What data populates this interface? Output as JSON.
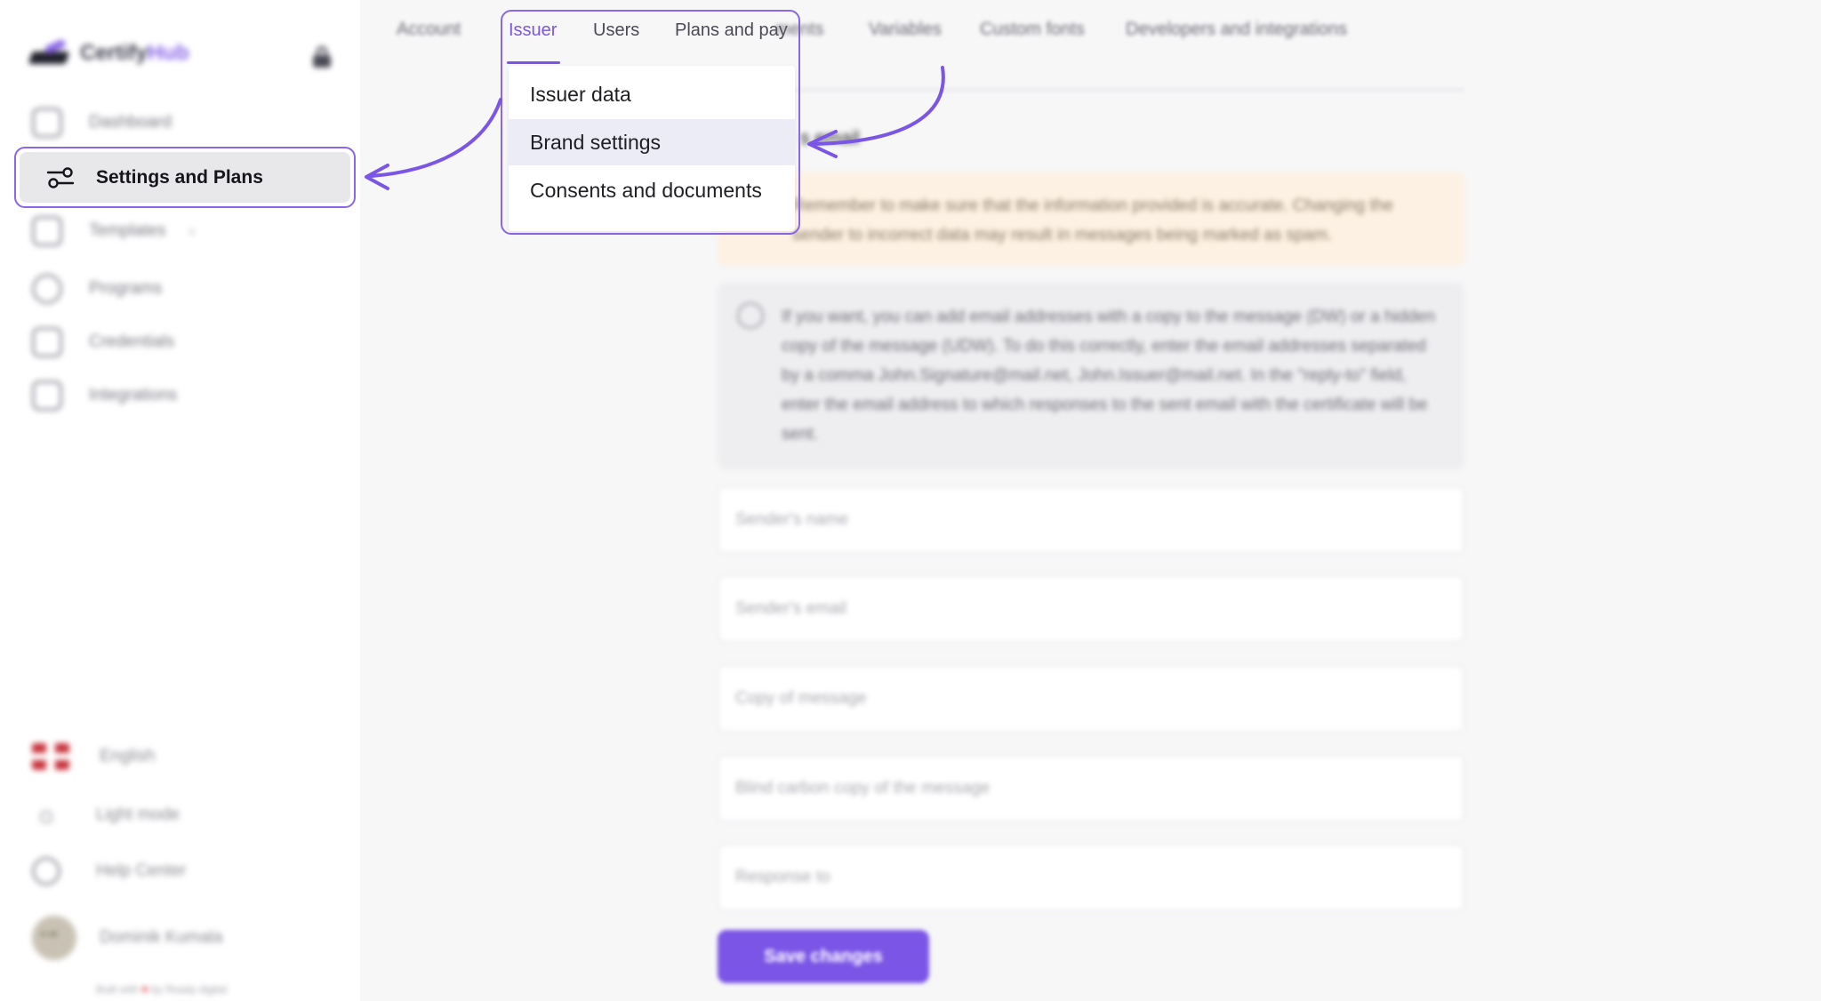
{
  "app": {
    "logo_text_a": "Certify",
    "logo_text_b": "Hub"
  },
  "sidebar": {
    "items": [
      {
        "label": "Dashboard",
        "icon": "home-icon"
      },
      {
        "label": "Settings and Plans",
        "icon": "sliders-icon",
        "active": true
      },
      {
        "label": "Templates",
        "icon": "template-icon",
        "chevron": "›"
      },
      {
        "label": "Programs",
        "icon": "user-icon"
      },
      {
        "label": "Credentials",
        "icon": "credential-icon"
      },
      {
        "label": "Integrations",
        "icon": "integrations-icon"
      }
    ],
    "bottom": {
      "language": "English",
      "theme": "Light mode",
      "help": "Help Center",
      "user": "Dominik Kumala",
      "built_a": "Built with",
      "built_heart": "♥",
      "built_b": "by Ready digital"
    }
  },
  "tabs": {
    "account": "Account",
    "issuer": "Issuer",
    "users": "Users",
    "plans": "Plans and payments",
    "plans_visible": "Plans and pay",
    "variables": "Variables",
    "custom_fonts": "Custom fonts",
    "developers": "Developers and integrations"
  },
  "dropdown": {
    "items": [
      {
        "label": "Issuer data"
      },
      {
        "label": "Brand settings",
        "highlighted": true
      },
      {
        "label": "Consents and documents"
      }
    ]
  },
  "content": {
    "section_title": "s email",
    "warning": "Remember to make sure that the information provided is accurate. Changing the sender to incorrect data may result in messages being marked as spam.",
    "info": "If you want, you can add email addresses with a copy to the message (DW) or a hidden copy of the message (UDW). To do this correctly, enter the email addresses separated by a comma John.Signature@mail.net, John.Issuer@mail.net. In the \"reply-to\" field, enter the email address to which responses to the sent email with the certificate will be sent.",
    "fields": {
      "sender_name": "Sender's name",
      "sender_email": "Sender's email",
      "copy": "Copy of message",
      "bcc": "Blind carbon copy of the message",
      "reply_to": "Response to"
    },
    "save_label": "Save changes"
  },
  "colors": {
    "accent": "#7b55e6",
    "highlight": "#8a66e8",
    "warning_bg": "#fdf1e3"
  }
}
